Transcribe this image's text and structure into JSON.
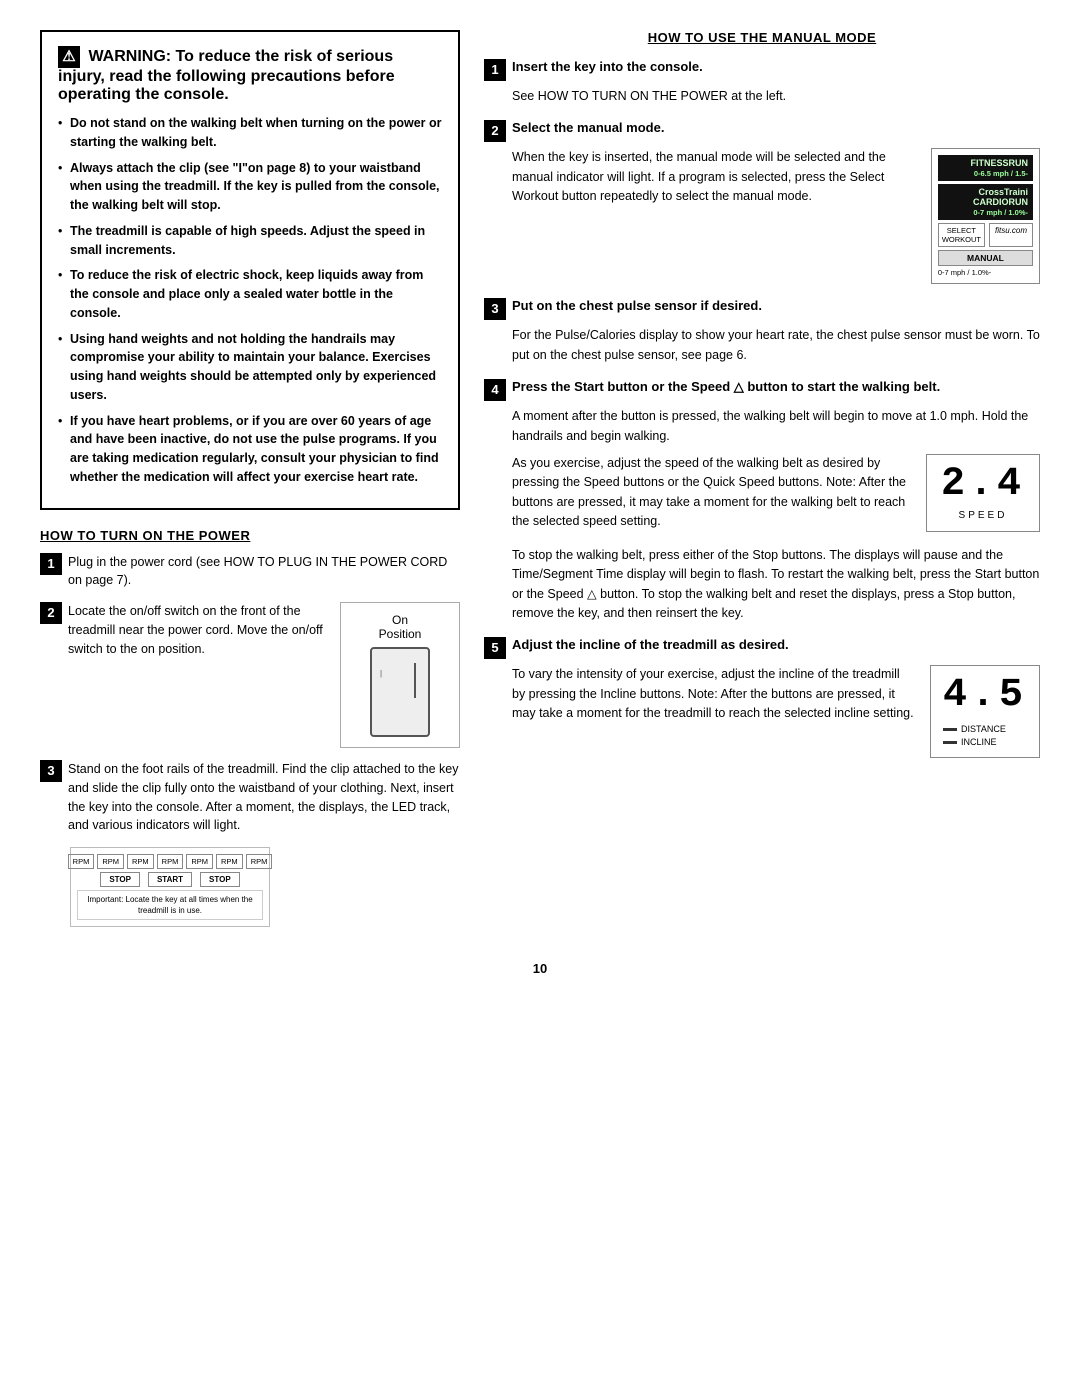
{
  "warning": {
    "title": "WARNING:",
    "title_rest": " To reduce the risk of serious injury, read the following precautions before operating the console.",
    "bullets": [
      "Do not stand on the walking belt when turning on the power or starting the walking belt.",
      "Always attach the clip (see \"I\"on page 8) to your waistband when using the treadmill. If the key is pulled from the console, the walking belt will stop.",
      "The treadmill is capable of high speeds. Adjust the speed in small increments.",
      "To reduce the risk of electric shock, keep liquids away from the console and place only a sealed water bottle in the console.",
      "Using hand weights and not holding the handrails may compromise your ability to maintain your balance. Exercises using hand weights should be attempted only by experienced users.",
      "If you have heart problems, or if you are over 60 years of age and have been inactive, do not use the pulse programs. If you are taking medication regularly, consult your physician to find whether the medication will affect your exercise heart rate."
    ]
  },
  "left_section": {
    "header": "HOW TO TURN ON THE POWER",
    "steps": [
      {
        "num": "1",
        "text": "Plug in the power cord (see HOW TO PLUG IN THE POWER CORD on page 7)."
      },
      {
        "num": "2",
        "text": "Locate the on/off switch on the front of the treadmill near the power cord. Move the on/off switch to the on position.",
        "image_label_top": "On",
        "image_label_bottom": "Position"
      },
      {
        "num": "3",
        "text_start": "Stand on the foot rails of the treadmill. Find the clip attached to the key and slide the clip fully onto the waistband of your clothing. Next, insert the key into the console. After a moment, the displays, the LED track, and various indicators will light."
      }
    ]
  },
  "right_section": {
    "header": "HOW TO USE THE MANUAL MODE",
    "steps": [
      {
        "num": "1",
        "title": "Insert the key into the console.",
        "text": "See HOW TO TURN ON THE POWER at the left."
      },
      {
        "num": "2",
        "title": "Select the manual mode.",
        "text": "When the key is inserted, the manual mode will be selected and the manual indicator will light. If a program is selected, press the Select Workout button repeatedly to select the manual mode."
      },
      {
        "num": "3",
        "title": "Put on the chest pulse sensor if desired.",
        "text": "For the Pulse/Calories display to show your heart rate, the chest pulse sensor must be worn. To put on the chest pulse sensor, see page 6."
      },
      {
        "num": "4",
        "title": "Press the Start button or the Speed △ button to start the walking belt.",
        "text1": "A moment after the button is pressed, the walking belt will begin to move at 1.0 mph. Hold the handrails and begin walking.",
        "text2": "As you exercise, adjust the speed of the walking belt as desired by pressing the Speed buttons or the Quick Speed buttons. Note: After the buttons are pressed, it may take a moment for the walking belt to reach the selected speed setting.",
        "speed_num": "2.4",
        "speed_label": "SPEED",
        "text3": "To stop the walking belt, press either of the Stop buttons. The displays will pause and the Time/Segment Time display will begin to flash. To restart the walking belt, press the Start button or the Speed △ button. To stop the walking belt and reset the displays, press a Stop button, remove the key, and then reinsert the key."
      },
      {
        "num": "5",
        "title": "Adjust the incline of the treadmill as desired.",
        "text1": "To vary the intensity of your exercise, adjust the incline of the treadmill by pressing the Incline buttons. Note: After the buttons are pressed, it may take a moment for",
        "incline_num": "4.5",
        "distance_label": "DISTANCE",
        "incline_label": "INCLINE",
        "text2": "the treadmill to reach the selected incline setting."
      }
    ]
  },
  "page_number": "10"
}
